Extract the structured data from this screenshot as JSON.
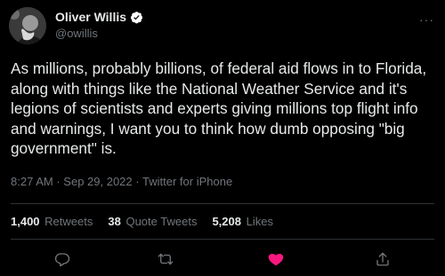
{
  "author": {
    "display_name": "Oliver Willis",
    "handle": "@owillis",
    "verified_icon": "verified-badge-icon",
    "avatar_icon": "avatar-photo"
  },
  "tweet": {
    "text": "As millions, probably billions, of federal aid flows in to Florida, along with things like the National Weather Service and it's legions of scientists and experts giving millions top flight info and warnings, I want you to think how dumb opposing \"big government\" is.",
    "time": "8:27 AM",
    "date": "Sep 29, 2022",
    "source": "Twitter for iPhone",
    "separator": "·"
  },
  "stats": {
    "retweets_count": "1,400",
    "retweets_label": "Retweets",
    "quote_count": "38",
    "quote_label": "Quote Tweets",
    "likes_count": "5,208",
    "likes_label": "Likes"
  },
  "actions": {
    "reply_icon": "reply-icon",
    "retweet_icon": "retweet-icon",
    "like_icon": "heart-icon",
    "share_icon": "share-icon"
  },
  "colors": {
    "background": "#000000",
    "text": "#e7e9ea",
    "secondary": "#71767b",
    "verified": "#1d9bf0",
    "like": "#f91880",
    "divider": "#2f3336"
  }
}
